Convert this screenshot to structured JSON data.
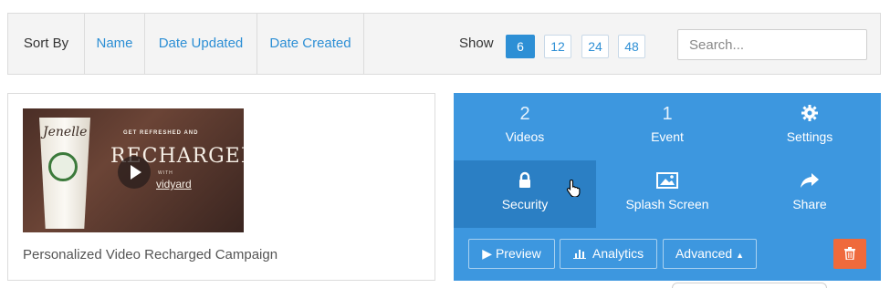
{
  "toolbar": {
    "sort_label": "Sort By",
    "sort_options": [
      "Name",
      "Date Updated",
      "Date Created"
    ],
    "show_label": "Show",
    "page_sizes": [
      "6",
      "12",
      "24",
      "48"
    ],
    "active_page_size": "6",
    "search_placeholder": "Search..."
  },
  "card": {
    "thumbnail": {
      "cup_text": "Jenelle",
      "tagline": "GET REFRESHED AND",
      "headline": "RECHARGED",
      "with": "WITH",
      "brand": "vidyard"
    },
    "title": "Personalized Video Recharged Campaign"
  },
  "panel": {
    "stats": [
      {
        "value": "2",
        "label": "Videos"
      },
      {
        "value": "1",
        "label": "Event"
      }
    ],
    "settings_label": "Settings",
    "security_label": "Security",
    "splash_label": "Splash Screen",
    "share_label": "Share",
    "preview_label": "Preview",
    "analytics_label": "Analytics",
    "advanced_label": "Advanced",
    "colors": {
      "panel": "#3d97df",
      "selected": "#2b7fc4",
      "delete": "#ef6a3c"
    }
  }
}
